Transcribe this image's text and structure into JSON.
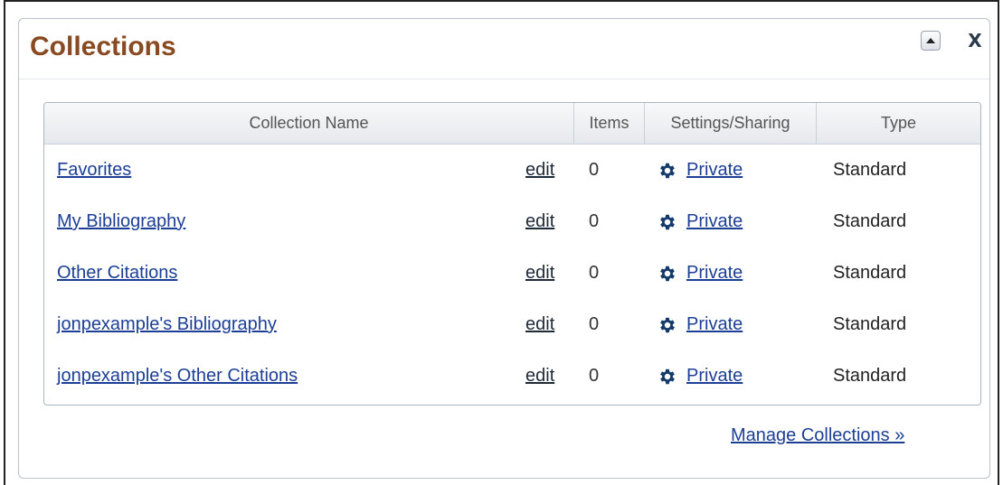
{
  "panel": {
    "title": "Collections",
    "collapse_icon": "triangle-up-icon",
    "close_label": "X"
  },
  "table": {
    "headers": {
      "name": "Collection Name",
      "items": "Items",
      "settings": "Settings/Sharing",
      "type": "Type"
    },
    "rows": [
      {
        "name": "Favorites",
        "edit": "edit",
        "items": "0",
        "sharing": "Private",
        "type": "Standard"
      },
      {
        "name": "My Bibliography",
        "edit": "edit",
        "items": "0",
        "sharing": "Private",
        "type": "Standard"
      },
      {
        "name": "Other Citations",
        "edit": "edit",
        "items": "0",
        "sharing": "Private",
        "type": "Standard"
      },
      {
        "name": "jonpexample's Bibliography",
        "edit": "edit",
        "items": "0",
        "sharing": "Private",
        "type": "Standard"
      },
      {
        "name": "jonpexample's Other Citations",
        "edit": "edit",
        "items": "0",
        "sharing": "Private",
        "type": "Standard"
      }
    ]
  },
  "footer": {
    "manage_label": "Manage Collections »"
  },
  "colors": {
    "title": "#8a4a21",
    "link": "#1c3f95",
    "gear": "#123a6b"
  }
}
